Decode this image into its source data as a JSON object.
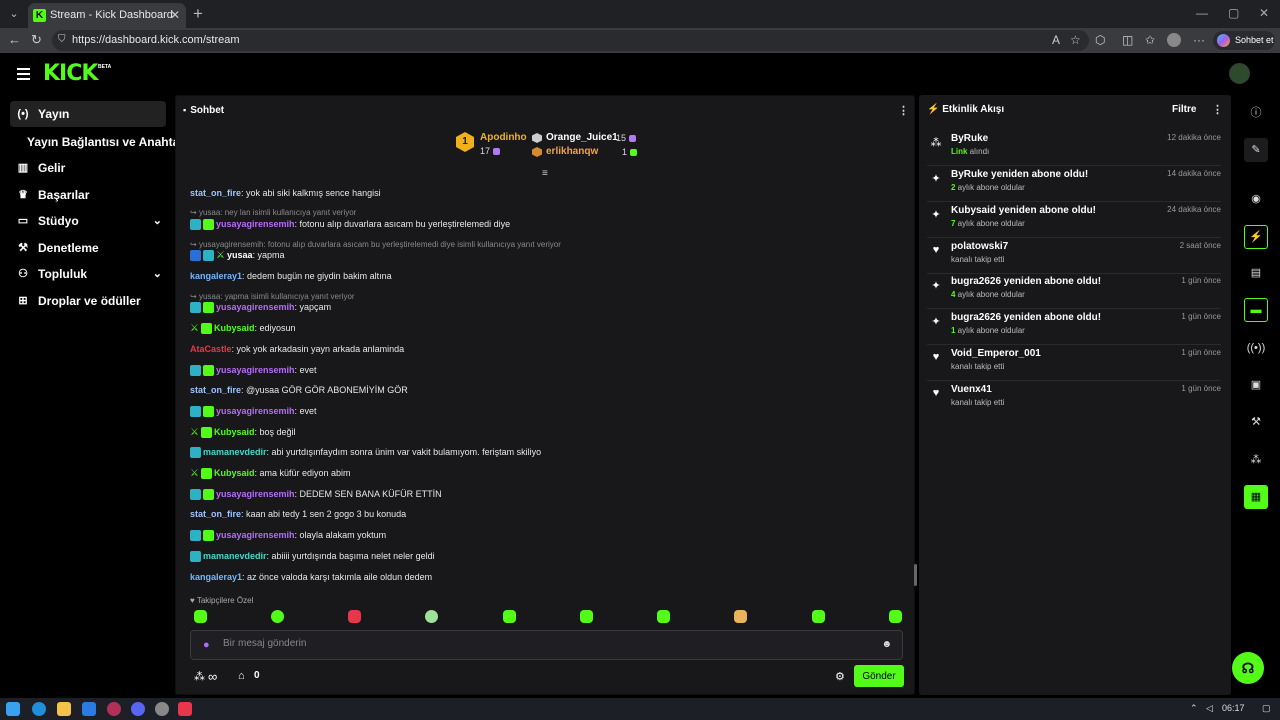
{
  "browser": {
    "tab_title": "Stream - Kick Dashboard",
    "tab_favicon_letter": "K",
    "tab_close": "✕",
    "new_tab": "+",
    "url": "https://dashboard.kick.com/stream",
    "copilot_label": "Sohbet et"
  },
  "header": {
    "logo": "KICK",
    "beta": "BETA"
  },
  "sidebar": {
    "items": [
      {
        "label": "Yayın",
        "icon": "broadcast-icon"
      },
      {
        "label": "Gelir",
        "icon": "chart-icon"
      },
      {
        "label": "Başarılar",
        "icon": "trophy-icon"
      },
      {
        "label": "Stüdyo",
        "icon": "studio-icon"
      },
      {
        "label": "Denetleme",
        "icon": "wrench-icon"
      },
      {
        "label": "Topluluk",
        "icon": "people-icon"
      },
      {
        "label": "Droplar ve ödüller",
        "icon": "gift-icon"
      }
    ],
    "subitem": "Yayın Bağlantısı ve Anahtarı"
  },
  "chat": {
    "title": "Sohbet",
    "top_gifters": [
      {
        "rank": "1",
        "name": "Apodinho",
        "count": "17"
      },
      {
        "name": "Orange_Juice1",
        "count": "15"
      },
      {
        "name": "erlikhanqw",
        "count": "1"
      }
    ],
    "messages": [
      {
        "user": "stat_on_fire",
        "text": ": yok abi siki kalkmış sence hangisi"
      },
      {
        "reply": "yusaa: ney lan isimli kullanıcıya yanıt veriyor"
      },
      {
        "user": "yusayagirensemih",
        "text": ": fotonu alıp duvarlara asıcam bu yerleştirelemedi diye"
      },
      {
        "reply": "yusayagirensemih: fotonu alıp duvarlara asıcam bu yerleştirelemedi diye isimli kullanıcıya yanıt veriyor"
      },
      {
        "user": "yusaa",
        "text": ": yapma"
      },
      {
        "user": "kangaleray1",
        "text": ": dedem bugün ne giydin bakim altına"
      },
      {
        "reply": "yusaa: yapma isimli kullanıcıya yanıt veriyor"
      },
      {
        "user": "yusayagirensemih",
        "text": ": yapçam"
      },
      {
        "user": "Kubysaid",
        "text": ": ediyosun"
      },
      {
        "user": "AtaCastle",
        "text": ": yok yok arkadasin yayn arkada anlaminda"
      },
      {
        "user": "yusayagirensemih",
        "text": ": evet"
      },
      {
        "user": "stat_on_fire",
        "text": ": @yusaa GÖR GÖR ABONEMİYİM GÖR"
      },
      {
        "user": "yusayagirensemih",
        "text": ": evet"
      },
      {
        "user": "Kubysaid",
        "text": ": boş değil"
      },
      {
        "user": "mamanevdedir",
        "text": ": abi yurtdışınfaydım sonra ünim var vakit bulamıyom. feriştam skiliyo"
      },
      {
        "user": "Kubysaid",
        "text": ": ama küfür ediyon abim"
      },
      {
        "user": "yusayagirensemih",
        "text": ": DEDEM SEN BANA KÜFÜR ETTİN"
      },
      {
        "user": "stat_on_fire",
        "text": ": kaan abi tedy 1 sen 2 gogo 3 bu konuda"
      },
      {
        "user": "yusayagirensemih",
        "text": ": olayla alakam yoktum"
      },
      {
        "user": "mamanevdedir",
        "text": ": abiiii yurtdışında başıma nelet neler geldi"
      },
      {
        "user": "kangaleray1",
        "text": ": az önce valoda karşı takımla aile oldun dedem"
      }
    ],
    "follower_note": "♥ Takipçilere Özel",
    "input_placeholder": "Bir mesaj gönderin",
    "bottom_infinity": "∞",
    "bottom_count": "0",
    "send_label": "Gönder"
  },
  "activity": {
    "title": "Etkinlik Akışı",
    "filter_label": "Filtre",
    "items": [
      {
        "icon": "drops-icon",
        "name": "ByRuke",
        "sub_hl": "Link",
        "sub": " alındı",
        "time": "12 dakika önce"
      },
      {
        "icon": "sparkle-icon",
        "name": "ByRuke yeniden abone oldu!",
        "sub_hl": "2",
        "sub": " aylık abone oldular",
        "time": "14 dakika önce"
      },
      {
        "icon": "sparkle-icon",
        "name": "Kubysaid yeniden abone oldu!",
        "sub_hl": "7",
        "sub": " aylık abone oldular",
        "time": "24 dakika önce"
      },
      {
        "icon": "heart-icon",
        "name": "polatowski7",
        "sub_hl": "",
        "sub": "kanalı takip etti",
        "time": "2 saat önce"
      },
      {
        "icon": "sparkle-icon",
        "name": "bugra2626 yeniden abone oldu!",
        "sub_hl": "4",
        "sub": " aylık abone oldular",
        "time": "1 gün önce"
      },
      {
        "icon": "sparkle-icon",
        "name": "bugra2626 yeniden abone oldu!",
        "sub_hl": "1",
        "sub": " aylık abone oldular",
        "time": "1 gün önce"
      },
      {
        "icon": "heart-icon",
        "name": "Void_Emperor_001",
        "sub_hl": "",
        "sub": "kanalı takip etti",
        "time": "1 gün önce"
      },
      {
        "icon": "heart-icon",
        "name": "Vuenx41",
        "sub_hl": "",
        "sub": "kanalı takip etti",
        "time": "1 gün önce"
      }
    ]
  },
  "taskbar": {
    "time": "06:17"
  },
  "colors": {
    "brand": "#53fc18",
    "panel": "#18181b"
  }
}
